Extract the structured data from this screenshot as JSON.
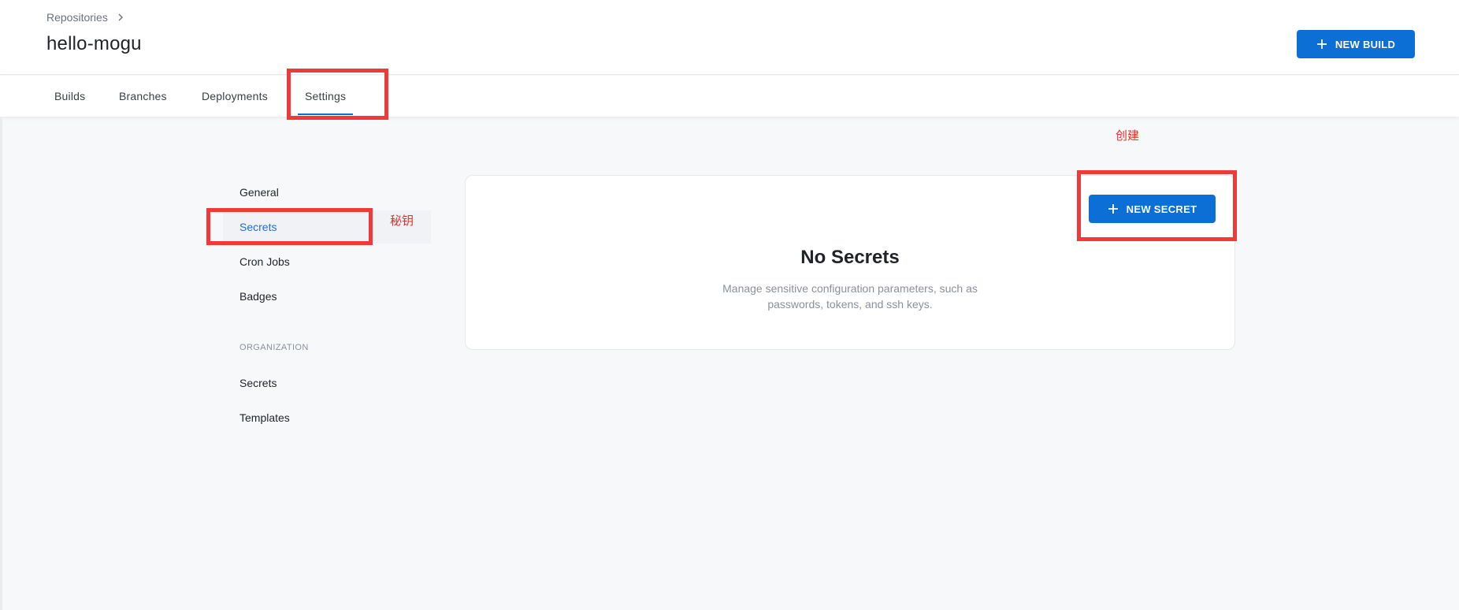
{
  "header": {
    "breadcrumb": "Repositories",
    "title": "hello-mogu",
    "new_build_label": "NEW BUILD"
  },
  "tabs": [
    {
      "label": "Builds"
    },
    {
      "label": "Branches"
    },
    {
      "label": "Deployments"
    },
    {
      "label": "Settings",
      "active": true
    }
  ],
  "sidebar": {
    "repo_items": [
      {
        "label": "General"
      },
      {
        "label": "Secrets",
        "active": true
      },
      {
        "label": "Cron Jobs"
      },
      {
        "label": "Badges"
      }
    ],
    "organization_label": "ORGANIZATION",
    "org_items": [
      {
        "label": "Secrets"
      },
      {
        "label": "Templates"
      }
    ]
  },
  "main": {
    "new_secret_label": "NEW SECRET",
    "empty_title": "No Secrets",
    "empty_desc_line1": "Manage sensitive configuration parameters, such as",
    "empty_desc_line2": "passwords, tokens, and ssh keys."
  },
  "annotations": {
    "secrets_note": "秘钥",
    "create_note": "创建",
    "highlight_color": "#ef3a3a"
  },
  "colors": {
    "accent": "#0b6fd6",
    "background": "#f7f8fa"
  }
}
